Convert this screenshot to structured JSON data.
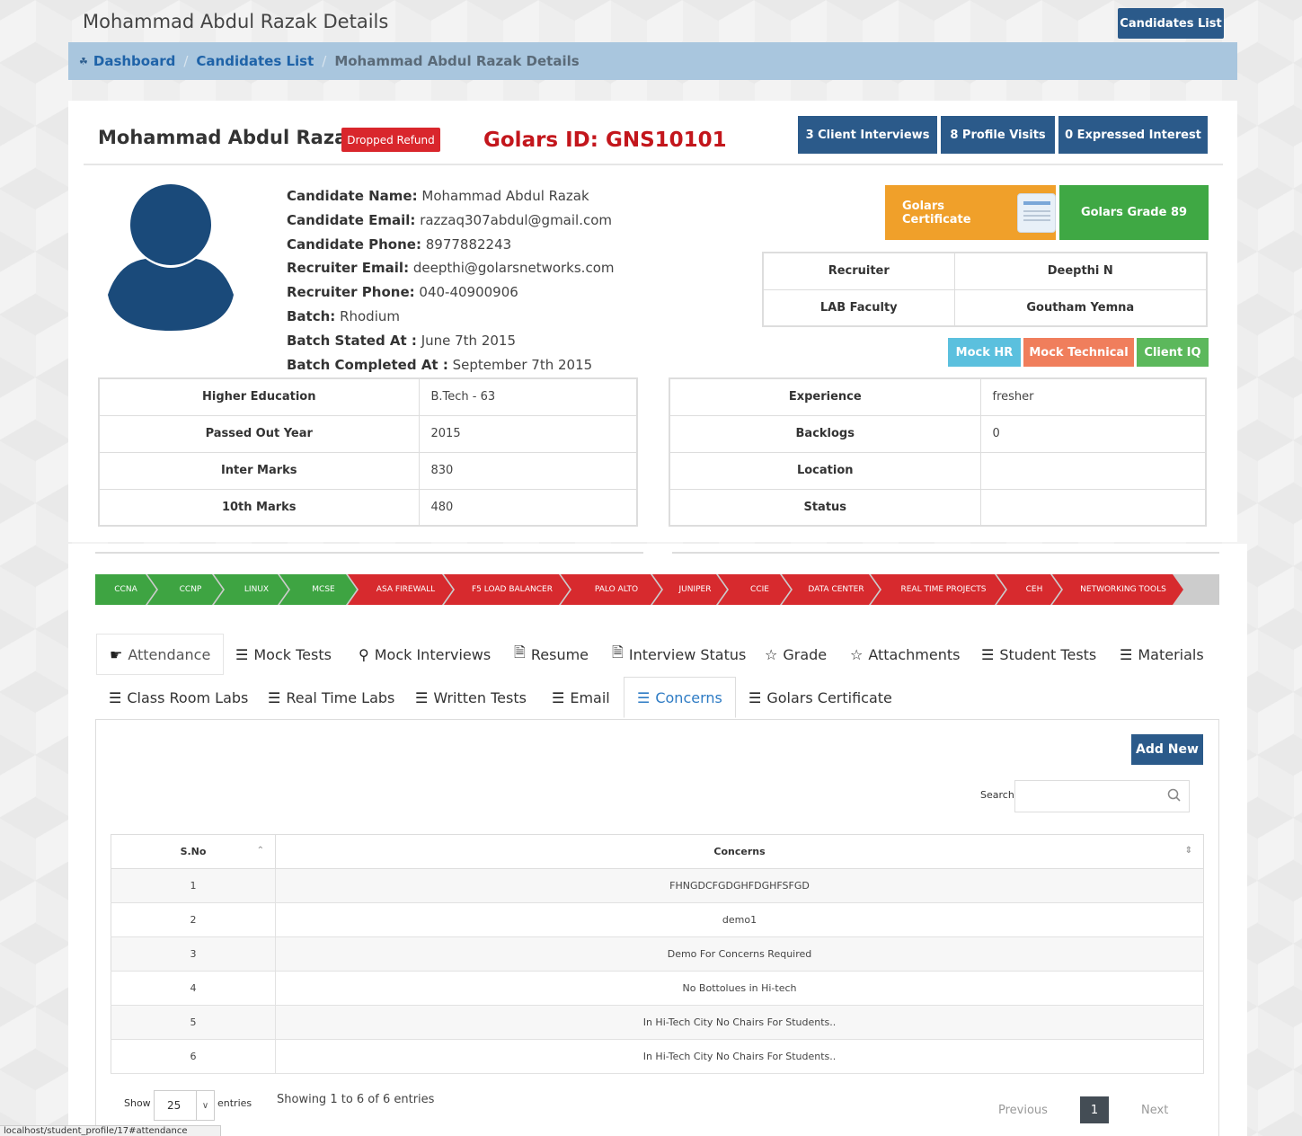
{
  "header": {
    "title": "Mohammad Abdul Razak Details",
    "candidates_list_button": "Candidates List"
  },
  "breadcrumb": {
    "items": [
      "Dashboard",
      "Candidates List",
      "Mohammad Abdul Razak Details"
    ]
  },
  "profile": {
    "name": "Mohammad Abdul Razak",
    "status_badge": "Dropped Refund",
    "golars_id": "Golars ID: GNS10101",
    "stats": [
      "3 Client Interviews",
      "8 Profile Visits",
      "0 Expressed Interest"
    ],
    "details": [
      {
        "label": "Candidate Name:",
        "value": "Mohammad Abdul Razak"
      },
      {
        "label": "Candidate Email:",
        "value": "razzaq307abdul@gmail.com"
      },
      {
        "label": "Candidate Phone:",
        "value": "8977882243"
      },
      {
        "label": "Recruiter Email:",
        "value": "deepthi@golarsnetworks.com"
      },
      {
        "label": "Recruiter Phone:",
        "value": "040-40900906"
      },
      {
        "label": "Batch:",
        "value": "Rhodium"
      },
      {
        "label": "Batch Stated At :",
        "value": "June 7th 2015"
      },
      {
        "label": "Batch Completed At :",
        "value": "September 7th 2015"
      }
    ],
    "certificate_button": "Golars Certificate",
    "grade_button": "Golars Grade 89",
    "staff": [
      {
        "label": "Recruiter",
        "value": "Deepthi N"
      },
      {
        "label": "LAB Faculty",
        "value": "Goutham Yemna"
      }
    ],
    "mock_buttons": [
      {
        "label": "Mock HR",
        "color": "#5bc0de"
      },
      {
        "label": "Mock Technical",
        "color": "#f07e5c"
      },
      {
        "label": "Client IQ",
        "color": "#5cb85c"
      }
    ],
    "education": [
      {
        "label": "Higher Education",
        "value": "B.Tech - 63"
      },
      {
        "label": "Passed Out Year",
        "value": "2015"
      },
      {
        "label": "Inter Marks",
        "value": "830"
      },
      {
        "label": "10th Marks",
        "value": "480"
      }
    ],
    "experience": [
      {
        "label": "Experience",
        "value": "fresher"
      },
      {
        "label": "Backlogs",
        "value": "0"
      },
      {
        "label": "Location",
        "value": ""
      },
      {
        "label": "Status",
        "value": ""
      }
    ]
  },
  "courses": [
    {
      "label": "CCNA",
      "status": "done"
    },
    {
      "label": "CCNP",
      "status": "done"
    },
    {
      "label": "LINUX",
      "status": "done"
    },
    {
      "label": "MCSE",
      "status": "done"
    },
    {
      "label": "ASA FIREWALL",
      "status": "pending"
    },
    {
      "label": "F5 LOAD BALANCER",
      "status": "pending"
    },
    {
      "label": "PALO ALTO",
      "status": "pending"
    },
    {
      "label": "JUNIPER",
      "status": "pending"
    },
    {
      "label": "CCIE",
      "status": "pending"
    },
    {
      "label": "DATA CENTER",
      "status": "pending"
    },
    {
      "label": "REAL TIME PROJECTS",
      "status": "pending"
    },
    {
      "label": "CEH",
      "status": "pending"
    },
    {
      "label": "NETWORKING TOOLS",
      "status": "pending"
    }
  ],
  "colors": {
    "done": "#3ea442",
    "pending": "#d72a2e",
    "primary": "#2b5a8a"
  },
  "tabs": [
    {
      "label": "Attendance",
      "icon": "hand-icon"
    },
    {
      "label": "Mock Tests",
      "icon": "list-icon"
    },
    {
      "label": "Mock Interviews",
      "icon": "key-icon"
    },
    {
      "label": "Resume",
      "icon": "file-icon"
    },
    {
      "label": "Interview Status",
      "icon": "file-icon"
    },
    {
      "label": "Grade",
      "icon": "star-icon"
    },
    {
      "label": "Attachments",
      "icon": "star-icon"
    },
    {
      "label": "Student Tests",
      "icon": "list-icon"
    },
    {
      "label": "Materials",
      "icon": "list-icon"
    },
    {
      "label": "Class Room Labs",
      "icon": "list-icon"
    },
    {
      "label": "Real Time Labs",
      "icon": "list-icon"
    },
    {
      "label": "Written Tests",
      "icon": "list-icon"
    },
    {
      "label": "Email",
      "icon": "list-icon"
    },
    {
      "label": "Concerns",
      "icon": "list-icon"
    },
    {
      "label": "Golars Certificate",
      "icon": "list-icon"
    }
  ],
  "active_tab": "Concerns",
  "concerns": {
    "add_new": "Add New",
    "search_label": "Search:",
    "search_value": "",
    "columns": [
      "S.No",
      "Concerns"
    ],
    "rows": [
      [
        "1",
        "FHNGDCFGDGHFDGHFSFGD"
      ],
      [
        "2",
        "demo1"
      ],
      [
        "3",
        "Demo For Concerns Required"
      ],
      [
        "4",
        "No Bottolues in Hi-tech"
      ],
      [
        "5",
        "In Hi-Tech City No Chairs For Students.."
      ],
      [
        "6",
        "In Hi-Tech City No Chairs For Students.."
      ]
    ],
    "show_label": "Show",
    "page_size": "25",
    "entries_label": "entries",
    "info": "Showing 1 to 6 of 6 entries",
    "prev": "Previous",
    "current_page": "1",
    "next": "Next"
  },
  "status_bar_url": "localhost/student_profile/17#attendance"
}
